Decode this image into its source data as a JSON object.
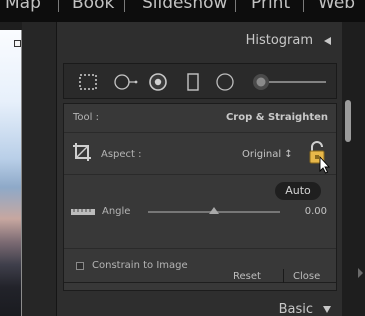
{
  "modules": [
    "Map",
    "Book",
    "Slideshow",
    "Print",
    "Web"
  ],
  "histogram": {
    "title": "Histogram"
  },
  "tools": [
    "crop-overlay-icon",
    "spot-removal-icon",
    "red-eye-icon",
    "graduated-filter-icon",
    "radial-filter-icon",
    "adjustment-brush-icon"
  ],
  "crop": {
    "tool_label": "Tool :",
    "tool_value": "Crop & Straighten",
    "aspect_label": "Aspect :",
    "aspect_value": "Original ↕",
    "auto_label": "Auto",
    "angle_label": "Angle",
    "angle_value": "0.00",
    "angle_level": 0.5,
    "constrain_label": "Constrain to Image",
    "reset_label": "Reset",
    "close_label": "Close"
  },
  "basic": {
    "title": "Basic"
  }
}
